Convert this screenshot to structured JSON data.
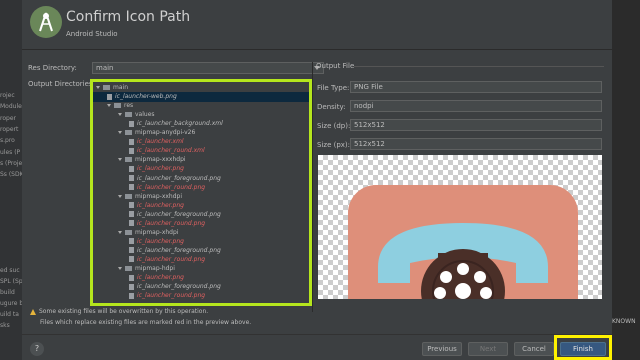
{
  "background": {
    "left_fragments": [
      "rojec",
      "Module",
      "roper",
      "ropert",
      "s.pro",
      "ules (P",
      "s (Proje",
      "Ss (SDK",
      "ed suc",
      "SPL (Sp",
      "build",
      "ugure bu",
      "uild ta",
      "sks"
    ],
    "right_fragment": "KNOWN"
  },
  "header": {
    "title": "Confirm Icon Path",
    "subtitle": "Android Studio"
  },
  "form": {
    "res_dir_label": "Res Directory:",
    "res_dir_value": "main",
    "output_dirs_label": "Output Directories:",
    "output_file_label": "Output File"
  },
  "tree": [
    {
      "label": "main",
      "kind": "folder",
      "expanded": true,
      "depth": 0,
      "red": false
    },
    {
      "label": "ic_launcher-web.png",
      "kind": "file",
      "depth": 1,
      "red": false,
      "italic": true,
      "selected": true
    },
    {
      "label": "res",
      "kind": "folder",
      "expanded": true,
      "depth": 1,
      "red": false
    },
    {
      "label": "values",
      "kind": "folder",
      "expanded": true,
      "depth": 2,
      "red": false
    },
    {
      "label": "ic_launcher_background.xml",
      "kind": "file",
      "depth": 3,
      "red": false,
      "italic": true
    },
    {
      "label": "mipmap-anydpi-v26",
      "kind": "folder",
      "expanded": true,
      "depth": 2,
      "red": false
    },
    {
      "label": "ic_launcher.xml",
      "kind": "file",
      "depth": 3,
      "red": true,
      "italic": true
    },
    {
      "label": "ic_launcher_round.xml",
      "kind": "file",
      "depth": 3,
      "red": true,
      "italic": true
    },
    {
      "label": "mipmap-xxxhdpi",
      "kind": "folder",
      "expanded": true,
      "depth": 2,
      "red": false
    },
    {
      "label": "ic_launcher.png",
      "kind": "file",
      "depth": 3,
      "red": true,
      "italic": true
    },
    {
      "label": "ic_launcher_foreground.png",
      "kind": "file",
      "depth": 3,
      "red": false,
      "italic": true
    },
    {
      "label": "ic_launcher_round.png",
      "kind": "file",
      "depth": 3,
      "red": true,
      "italic": true
    },
    {
      "label": "mipmap-xxhdpi",
      "kind": "folder",
      "expanded": true,
      "depth": 2,
      "red": false
    },
    {
      "label": "ic_launcher.png",
      "kind": "file",
      "depth": 3,
      "red": true,
      "italic": true
    },
    {
      "label": "ic_launcher_foreground.png",
      "kind": "file",
      "depth": 3,
      "red": false,
      "italic": true
    },
    {
      "label": "ic_launcher_round.png",
      "kind": "file",
      "depth": 3,
      "red": true,
      "italic": true
    },
    {
      "label": "mipmap-xhdpi",
      "kind": "folder",
      "expanded": true,
      "depth": 2,
      "red": false
    },
    {
      "label": "ic_launcher.png",
      "kind": "file",
      "depth": 3,
      "red": true,
      "italic": true
    },
    {
      "label": "ic_launcher_foreground.png",
      "kind": "file",
      "depth": 3,
      "red": false,
      "italic": true
    },
    {
      "label": "ic_launcher_round.png",
      "kind": "file",
      "depth": 3,
      "red": true,
      "italic": true
    },
    {
      "label": "mipmap-hdpi",
      "kind": "folder",
      "expanded": true,
      "depth": 2,
      "red": false
    },
    {
      "label": "ic_launcher.png",
      "kind": "file",
      "depth": 3,
      "red": true,
      "italic": true
    },
    {
      "label": "ic_launcher_foreground.png",
      "kind": "file",
      "depth": 3,
      "red": false,
      "italic": true
    },
    {
      "label": "ic_launcher_round.png",
      "kind": "file",
      "depth": 3,
      "red": true,
      "italic": true
    }
  ],
  "output": {
    "file_type_label": "File Type:",
    "file_type_value": "PNG File",
    "density_label": "Density:",
    "density_value": "nodpi",
    "size_dp_label": "Size (dp):",
    "size_dp_value": "512x512",
    "size_px_label": "Size (px):",
    "size_px_value": "512x512"
  },
  "warnings": {
    "line1": "Some existing files will be overwritten by this operation.",
    "line2": "Files which replace existing files are marked red in the preview above."
  },
  "footer": {
    "help": "?",
    "previous": "Previous",
    "next": "Next",
    "cancel": "Cancel",
    "finish": "Finish"
  },
  "colors": {
    "dialog_bg": "#3c3f41",
    "tree_highlight": "#b5e61d",
    "finish_highlight": "#fff200",
    "overwrite_red": "#e06060",
    "icon_bg": "#de8f7a",
    "phone_blue": "#8ecfe0",
    "phone_dark": "#4a2f28"
  }
}
